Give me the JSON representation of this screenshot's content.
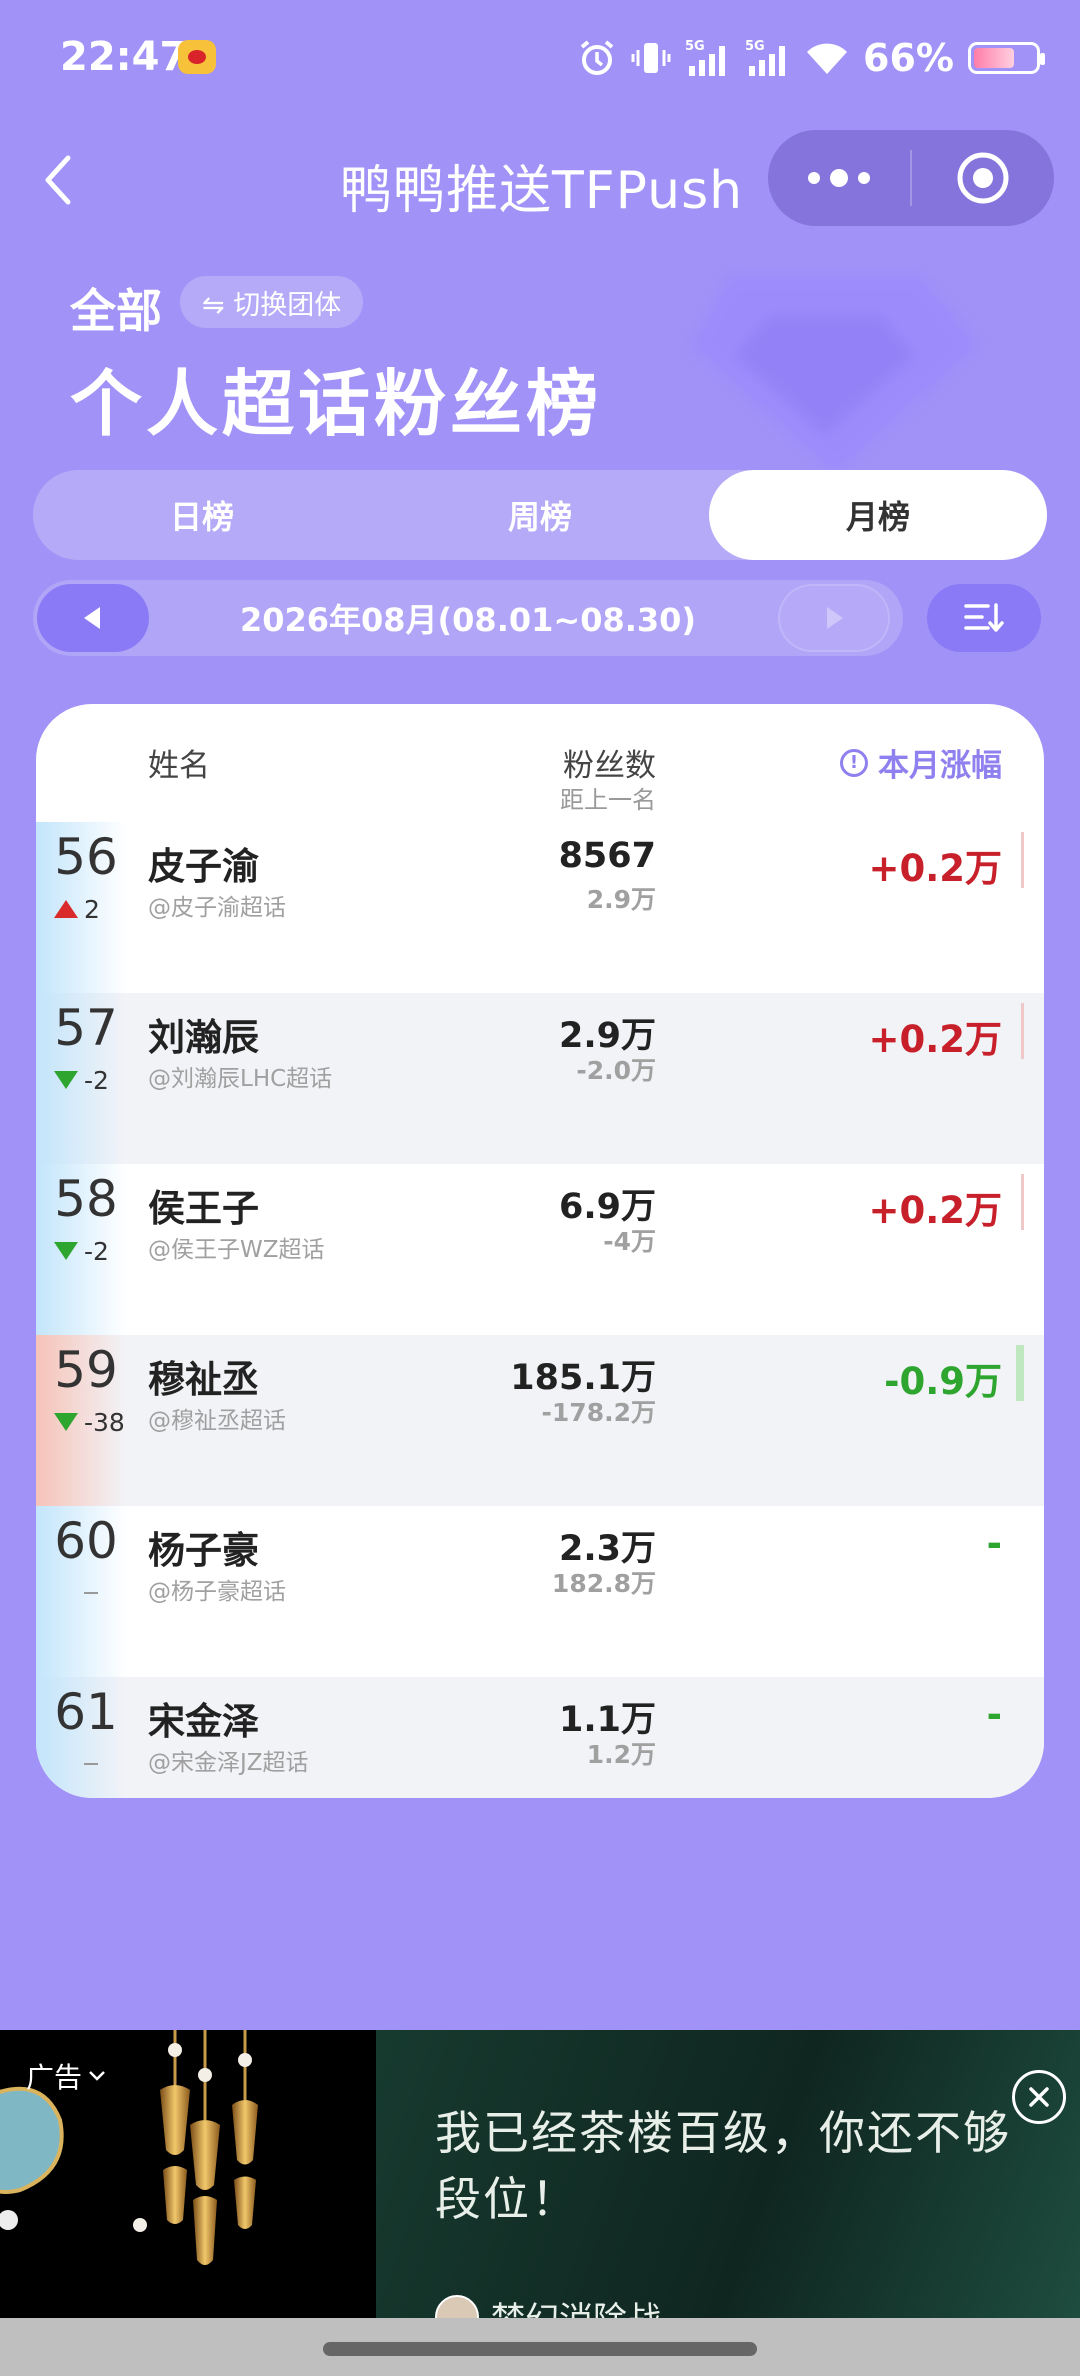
{
  "status_bar": {
    "time": "22:47",
    "battery": "66%",
    "battery_level": 0.66,
    "icons": [
      "weibo-icon",
      "alarm-icon",
      "vibrate-icon",
      "signal-5g-icon",
      "signal-5g-icon",
      "wifi-icon",
      "battery-icon"
    ]
  },
  "nav": {
    "title": "鸭鸭推送TFPush",
    "icons": [
      "back-icon",
      "more-icon",
      "target-icon"
    ]
  },
  "header": {
    "scope": "全部",
    "switch_label": "⇋ 切换团体",
    "title": "个人超话粉丝榜"
  },
  "tabs": [
    {
      "label": "日榜",
      "active": false
    },
    {
      "label": "周榜",
      "active": false
    },
    {
      "label": "月榜",
      "active": true
    }
  ],
  "date_range": "2026年08月(08.01~08.30)",
  "table": {
    "headers": {
      "name": "姓名",
      "fans": "粉丝数",
      "gap": "距上一名",
      "change": "本月涨幅"
    },
    "rows": [
      {
        "rank": "56",
        "rank_change": "2",
        "direction": "up",
        "name": "皮子渝",
        "handle": "@皮子渝超话",
        "fans": "8567",
        "gap": "2.9万",
        "change": "+0.2万",
        "change_type": "up"
      },
      {
        "rank": "57",
        "rank_change": "-2",
        "direction": "down",
        "name": "刘瀚辰",
        "handle": "@刘瀚辰LHC超话",
        "fans": "2.9万",
        "gap": "-2.0万",
        "change": "+0.2万",
        "change_type": "up"
      },
      {
        "rank": "58",
        "rank_change": "-2",
        "direction": "down",
        "name": "侯王子",
        "handle": "@侯王子WZ超话",
        "fans": "6.9万",
        "gap": "-4万",
        "change": "+0.2万",
        "change_type": "up"
      },
      {
        "rank": "59",
        "rank_change": "-38",
        "direction": "down",
        "name": "穆祉丞",
        "handle": "@穆祉丞超话",
        "fans": "185.1万",
        "gap": "-178.2万",
        "change": "-0.9万",
        "change_type": "down"
      },
      {
        "rank": "60",
        "rank_change": "",
        "direction": "none",
        "name": "杨子豪",
        "handle": "@杨子豪超话",
        "fans": "2.3万",
        "gap": "182.8万",
        "change": "-",
        "change_type": "none"
      },
      {
        "rank": "61",
        "rank_change": "",
        "direction": "none",
        "name": "宋金泽",
        "handle": "@宋金泽JZ超话",
        "fans": "1.1万",
        "gap": "1.2万",
        "change": "-",
        "change_type": "none"
      }
    ]
  },
  "ad": {
    "label": "广告",
    "headline": "我已经茶楼百级，你还不够段位！",
    "brand": "梦幻消除战"
  },
  "colors": {
    "background": "#a092f7",
    "accent": "#8f80ef",
    "up": "#c8202a",
    "down": "#2ea52e"
  }
}
